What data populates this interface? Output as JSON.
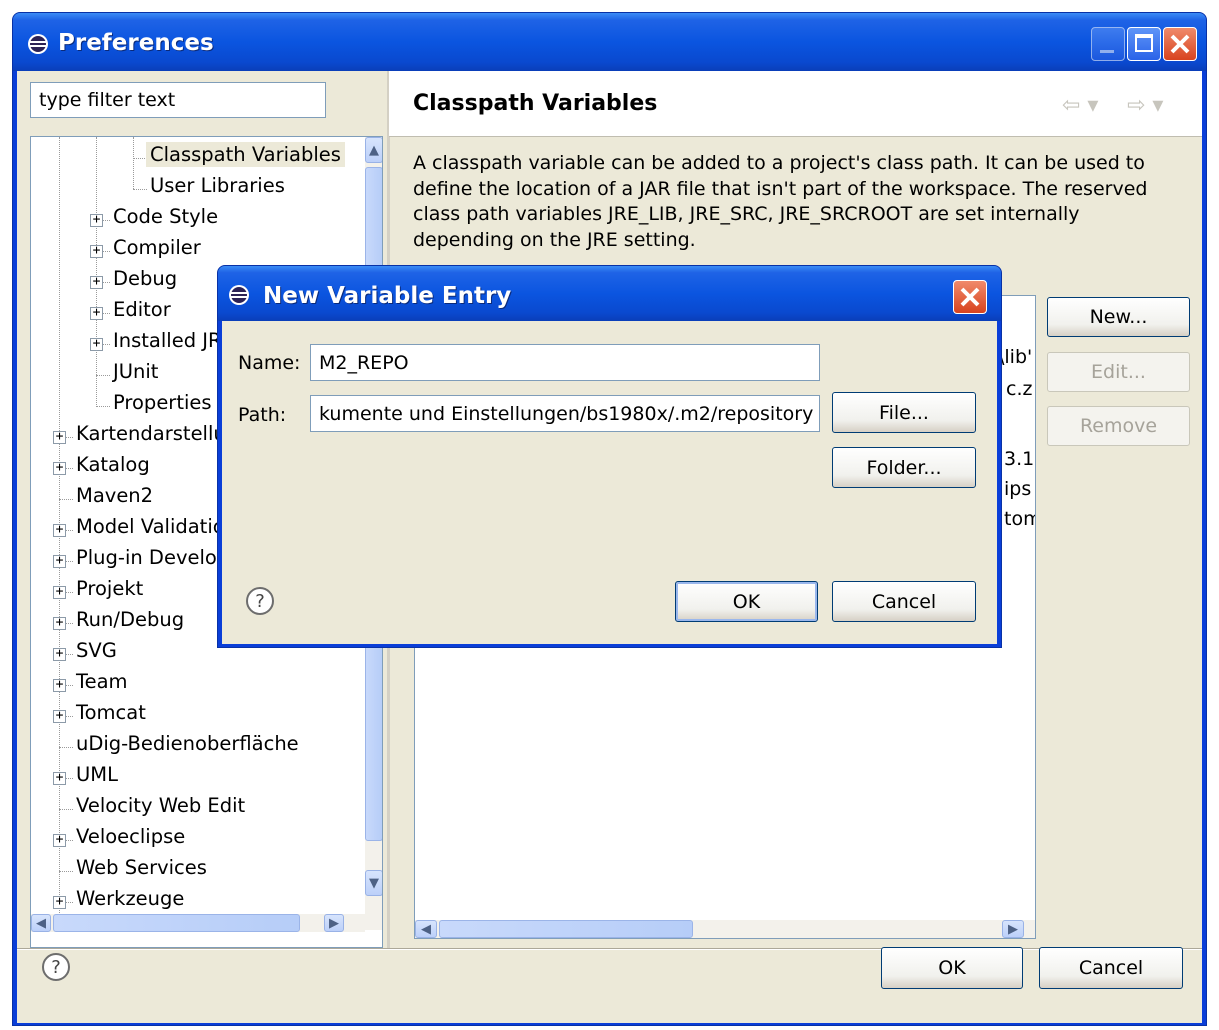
{
  "window": {
    "title": "Preferences",
    "icon": "eclipse-icon",
    "controls": {
      "minimize": "minimize-icon",
      "maximize": "maximize-icon",
      "close": "close-icon"
    }
  },
  "filter": {
    "value": "type filter text"
  },
  "tree": {
    "items": [
      {
        "label": "Classpath Variables",
        "level": 3,
        "expander": false,
        "selected": true
      },
      {
        "label": "User Libraries",
        "level": 3,
        "expander": false
      },
      {
        "label": "Code Style",
        "level": 2,
        "expander": true
      },
      {
        "label": "Compiler",
        "level": 2,
        "expander": true
      },
      {
        "label": "Debug",
        "level": 2,
        "expander": true
      },
      {
        "label": "Editor",
        "level": 2,
        "expander": true
      },
      {
        "label": "Installed JR",
        "level": 2,
        "expander": true
      },
      {
        "label": "JUnit",
        "level": 2,
        "expander": false
      },
      {
        "label": "Properties F",
        "level": 2,
        "expander": false
      },
      {
        "label": "Kartendarstellu",
        "level": 1,
        "expander": true
      },
      {
        "label": "Katalog",
        "level": 1,
        "expander": true
      },
      {
        "label": "Maven2",
        "level": 1,
        "expander": false
      },
      {
        "label": "Model Validatio",
        "level": 1,
        "expander": true
      },
      {
        "label": "Plug-in Develop",
        "level": 1,
        "expander": true
      },
      {
        "label": "Projekt",
        "level": 1,
        "expander": true
      },
      {
        "label": "Run/Debug",
        "level": 1,
        "expander": true
      },
      {
        "label": "SVG",
        "level": 1,
        "expander": true
      },
      {
        "label": "Team",
        "level": 1,
        "expander": true
      },
      {
        "label": "Tomcat",
        "level": 1,
        "expander": true
      },
      {
        "label": "uDig-Bedienoberfläche",
        "level": 1,
        "expander": false
      },
      {
        "label": "UML",
        "level": 1,
        "expander": true
      },
      {
        "label": "Velocity Web Edit",
        "level": 1,
        "expander": false
      },
      {
        "label": "Veloeclipse",
        "level": 1,
        "expander": true
      },
      {
        "label": "Web Services",
        "level": 1,
        "expander": false
      },
      {
        "label": "Werkzeuge",
        "level": 1,
        "expander": true
      }
    ]
  },
  "page": {
    "title": "Classpath Variables",
    "nav": {
      "back": "back-arrow-icon",
      "forward": "forward-arrow-icon"
    },
    "description": "A classpath variable can be added to a project's class path. It can be used to define the location of a JAR file that isn't part of the workspace. The reserved class path variables JRE_LIB, JRE_SRC, JRE_SRCROOT are set internally depending on the JRE setting.",
    "list_fragments": [
      "\\lib'",
      "c.z",
      "3.1",
      "ips",
      "tom"
    ],
    "buttons": {
      "new": "New...",
      "edit": "Edit...",
      "remove": "Remove"
    }
  },
  "footer": {
    "ok": "OK",
    "cancel": "Cancel"
  },
  "dialog": {
    "title": "New Variable Entry",
    "name_label": "Name:",
    "name_value": "M2_REPO",
    "path_label": "Path:",
    "path_value": "kumente und Einstellungen/bs1980x/.m2/repository",
    "file_button": "File...",
    "folder_button": "Folder...",
    "ok": "OK",
    "cancel": "Cancel"
  },
  "colors": {
    "titlebar": "#0b55e0",
    "dialog_face": "#ece9d8",
    "selection": "#ece9d8"
  }
}
